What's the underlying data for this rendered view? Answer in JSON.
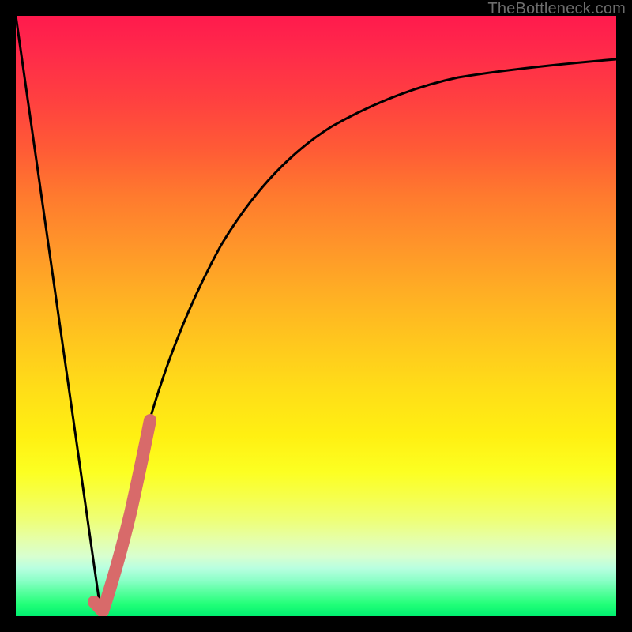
{
  "watermark": {
    "text": "TheBottleneck.com"
  },
  "colors": {
    "background": "#000000",
    "curve": "#000000",
    "highlight": "#d86a6a"
  },
  "chart_data": {
    "type": "line",
    "title": "",
    "xlabel": "",
    "ylabel": "",
    "xlim": [
      0,
      100
    ],
    "ylim": [
      0,
      100
    ],
    "grid": false,
    "legend": false,
    "series": [
      {
        "name": "left-falling-segment",
        "x": [
          0,
          14
        ],
        "y": [
          100,
          0
        ]
      },
      {
        "name": "right-log-curve",
        "x": [
          14,
          18,
          22,
          26,
          30,
          35,
          40,
          45,
          50,
          55,
          60,
          65,
          70,
          75,
          80,
          85,
          90,
          95,
          100
        ],
        "y": [
          0,
          18,
          33,
          45,
          55,
          63,
          69,
          74,
          78,
          81,
          83.5,
          85.5,
          87,
          88.2,
          89.2,
          90,
          90.6,
          91.1,
          91.5
        ]
      },
      {
        "name": "highlighted-range",
        "x": [
          13,
          14,
          16,
          18,
          20,
          22
        ],
        "y": [
          1.5,
          0.5,
          9,
          18,
          26,
          33
        ]
      }
    ]
  }
}
